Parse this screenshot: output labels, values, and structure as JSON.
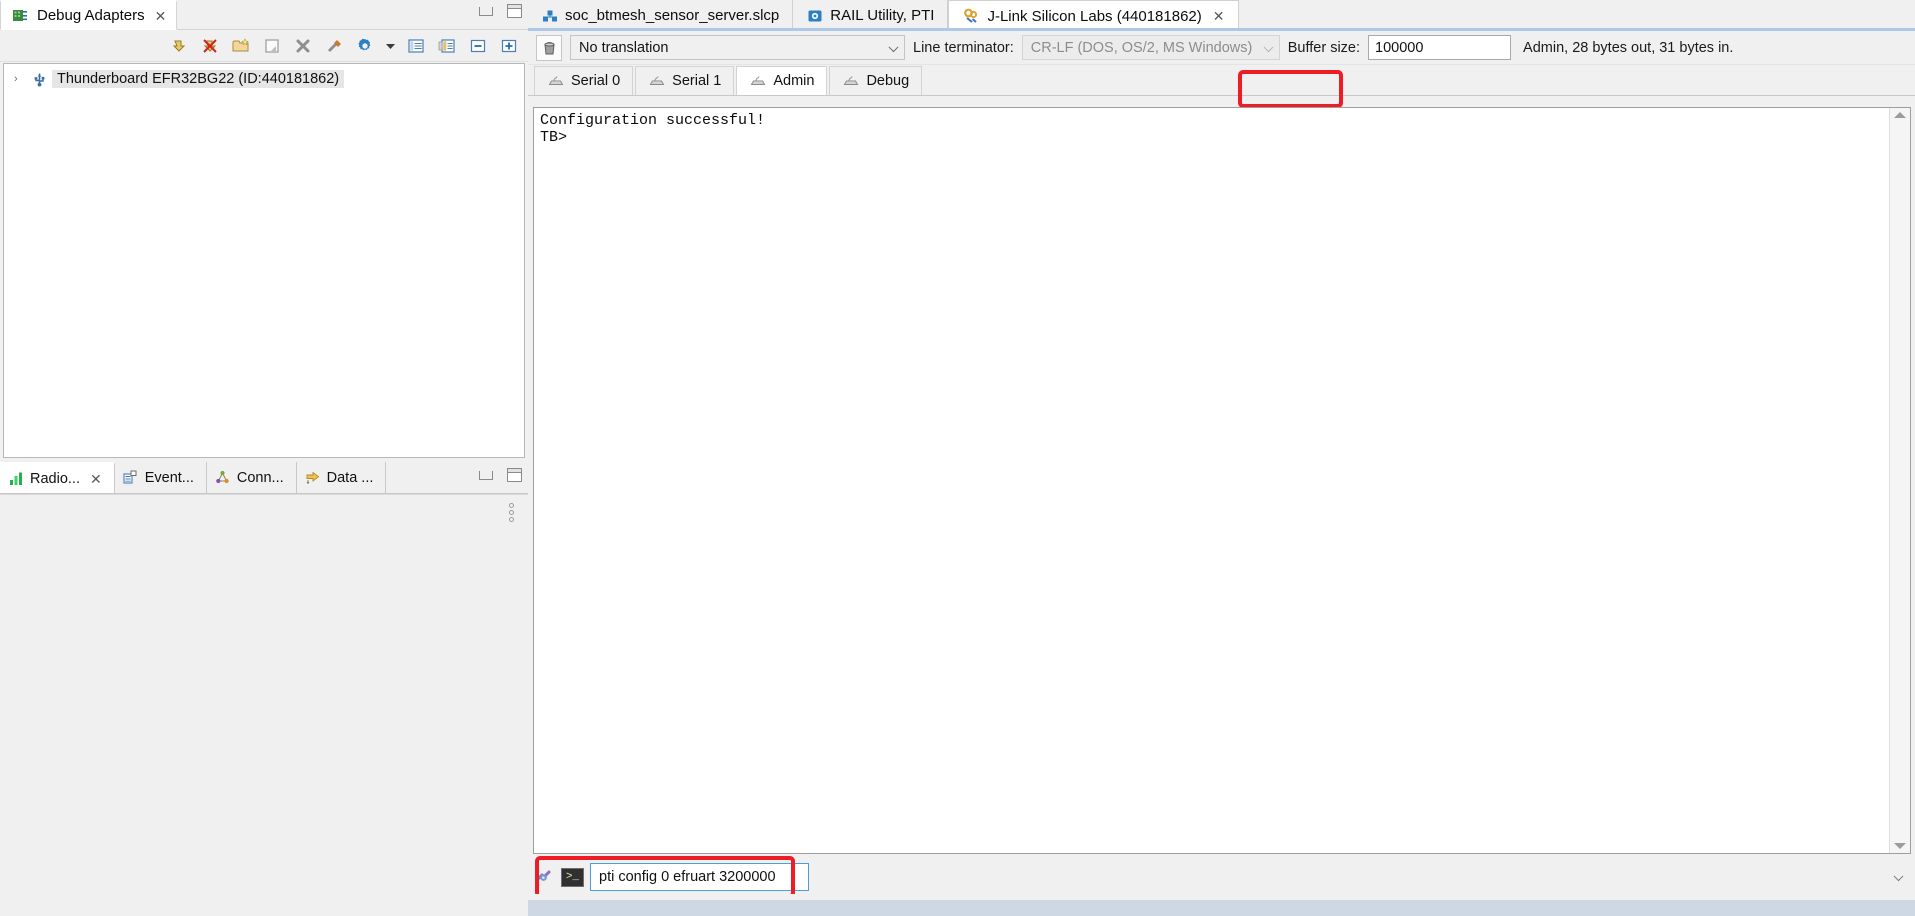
{
  "left_panel": {
    "view_tab": {
      "label": "Debug Adapters",
      "icon": "debug-adapters-icon",
      "close": "✕"
    },
    "window_buttons": {
      "minimize": "minimize-icon",
      "maximize": "maximize-icon"
    },
    "toolbar_icons": [
      "connect-adapter-icon",
      "disconnect-adapter-icon",
      "new-folder-icon",
      "rename-icon",
      "delete-icon",
      "configure-tools-icon",
      "settings-gear-icon",
      "dropdown-arrow-icon",
      "show-details-icon",
      "show-console-icon",
      "collapse-all-icon",
      "expand-all-icon"
    ],
    "tree": {
      "items": [
        {
          "arrow": "›",
          "icon": "usb-device-icon",
          "label": "Thunderboard EFR32BG22 (ID:440181862)"
        }
      ]
    }
  },
  "lower_left_panel": {
    "tabs": [
      {
        "label": "Radio...",
        "icon": "radio-bars-icon",
        "active": true,
        "close": "✕"
      },
      {
        "label": "Event...",
        "icon": "event-table-icon",
        "active": false
      },
      {
        "label": "Conn...",
        "icon": "connection-graph-icon",
        "active": false
      },
      {
        "label": "Data ...",
        "icon": "data-arrow-icon",
        "active": false
      }
    ],
    "window_buttons": {
      "minimize": "minimize-icon",
      "maximize": "maximize-icon"
    },
    "view_menu": "view-menu-dots-icon"
  },
  "editor_tabs": [
    {
      "label": "soc_btmesh_sensor_server.slcp",
      "icon": "slcp-project-icon",
      "active": false
    },
    {
      "label": "RAIL Utility, PTI",
      "icon": "rail-utility-icon",
      "active": false
    },
    {
      "label": "J-Link Silicon Labs (440181862)",
      "icon": "jlink-icon",
      "active": true,
      "close": "✕"
    }
  ],
  "toolbar": {
    "trash_icon": "clear-console-icon",
    "translation": {
      "value": "No translation"
    },
    "line_terminator": {
      "label": "Line terminator:",
      "value": "CR-LF  (DOS, OS/2, MS Windows)",
      "disabled": true
    },
    "buffer_size": {
      "label": "Buffer size:",
      "value": "100000"
    },
    "status": "Admin, 28 bytes out, 31 bytes in."
  },
  "terminal_tabs": [
    {
      "label": "Serial 0",
      "icon": "serial-port-icon",
      "active": false
    },
    {
      "label": "Serial 1",
      "icon": "serial-port-icon",
      "active": false
    },
    {
      "label": "Admin",
      "icon": "serial-port-icon",
      "active": true,
      "highlighted": true
    },
    {
      "label": "Debug",
      "icon": "serial-port-icon",
      "active": false
    }
  ],
  "terminal": {
    "output": "Configuration successful!\nTB>",
    "scroll_up": "scroll-up-arrow-icon",
    "scroll_down": "scroll-down-arrow-icon"
  },
  "command_bar": {
    "link_icon": "link-broken-icon",
    "console_icon": "console-prompt-icon",
    "input_value": "pti config 0 efruart 3200000",
    "dropdown": "history-dropdown-icon",
    "highlighted": true
  },
  "colors": {
    "highlight": "#ee1c25",
    "focus_border": "#4a9edd",
    "tab_accent": "#aec9e8",
    "panel_bg": "#f0f0f0"
  }
}
